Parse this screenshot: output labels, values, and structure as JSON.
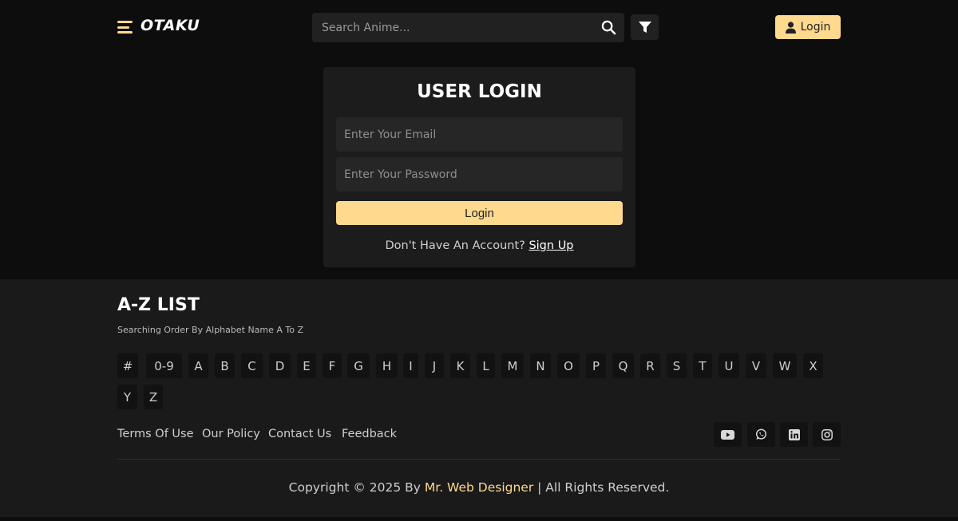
{
  "header": {
    "logo": "OTAKU",
    "search_placeholder": "Search Anime...",
    "login_label": "Login"
  },
  "login_card": {
    "title": "USER LOGIN",
    "email_placeholder": "Enter Your Email",
    "password_placeholder": "Enter Your Password",
    "submit_label": "Login",
    "signup_prompt": "Don't Have An Account?",
    "signup_link": "Sign Up"
  },
  "az_list": {
    "title": "A-Z LIST",
    "subtitle": "Searching Order By Alphabet Name A To Z",
    "letters": [
      "#",
      "0-9",
      "A",
      "B",
      "C",
      "D",
      "E",
      "F",
      "G",
      "H",
      "I",
      "J",
      "K",
      "L",
      "M",
      "N",
      "O",
      "P",
      "Q",
      "R",
      "S",
      "T",
      "U",
      "V",
      "W",
      "X",
      "Y",
      "Z"
    ]
  },
  "footer": {
    "links": [
      "Terms Of Use",
      "Our Policy",
      "Contact Us",
      "Feedback"
    ],
    "social_icons": [
      "youtube-icon",
      "whatsapp-icon",
      "linkedin-icon",
      "instagram-icon"
    ],
    "copyright_prefix": "Copyright © 2025 By",
    "copyright_brand": "Mr. Web Designer",
    "copyright_suffix": "| All Rights Reserved."
  },
  "colors": {
    "accent": "#ffd98e",
    "background": "#0d0d0d",
    "panel": "#1c1c1c",
    "footer": "#1a1a1a"
  }
}
